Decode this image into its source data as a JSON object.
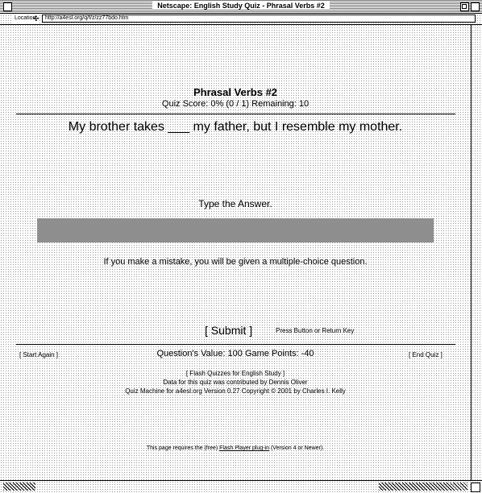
{
  "window": {
    "title": "Netscape: English Study Quiz - Phrasal Verbs #2"
  },
  "location": {
    "label": "Location:",
    "url": "http://a4esl.org/q/f/z/zz77bdo.htm"
  },
  "quiz": {
    "title": "Phrasal Verbs #2",
    "score_line": "Quiz Score: 0% (0 / 1)  Remaining: 10",
    "question": "My brother takes ___ my father, but I resemble my mother.",
    "prompt": "Type the Answer.",
    "answer_value": "",
    "mistake_note": "If you make a mistake, you will be given a multiple-choice question.",
    "submit_label": "[ Submit ]",
    "submit_hint": "Press Button or Return Key"
  },
  "footer": {
    "start_again": "[ Start Again ]",
    "values": "Question's Value: 100   Game Points: -40",
    "end_quiz": "[ End Quiz ]",
    "flash_quizzes": "[ Flash Quizzes for English Study ]",
    "contributed": "Data for this quiz was contributed by Dennis Oliver",
    "machine": "Quiz Machine for a4esl.org Version 0.27   Copyright © 2001 by Charles I. Kelly",
    "plugin_pre": "This page requires the (free) ",
    "plugin_link": "Flash Player plug-in",
    "plugin_post": " (Version 4 or Newer)."
  }
}
